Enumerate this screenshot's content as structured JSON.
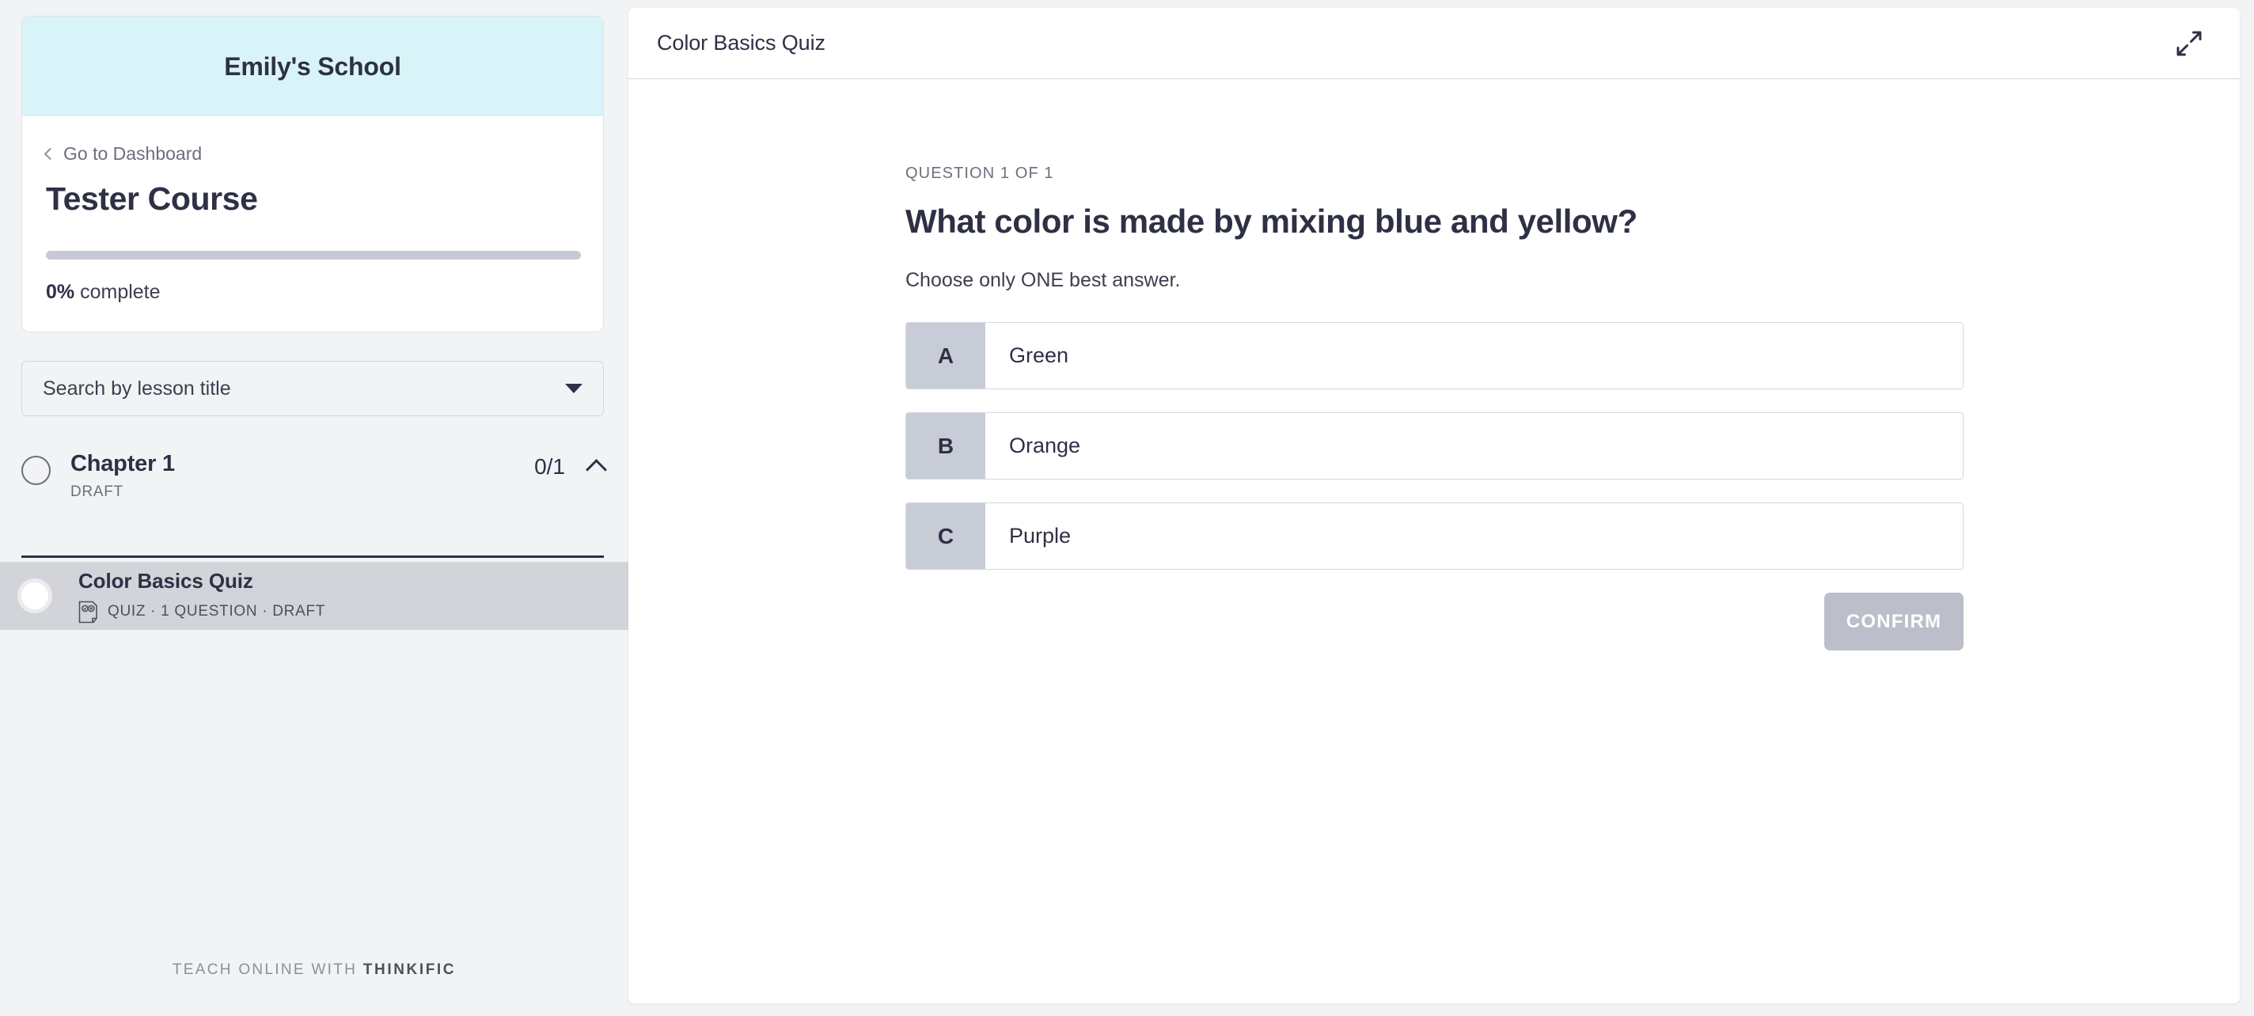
{
  "sidebar": {
    "school_name": "Emily's School",
    "back_link": "Go to Dashboard",
    "course_title": "Tester Course",
    "progress_percent": 0,
    "progress_value": "0%",
    "progress_suffix": "complete",
    "search_placeholder": "Search by lesson title",
    "chapter": {
      "title": "Chapter 1",
      "status": "DRAFT",
      "count": "0/1"
    },
    "lesson": {
      "title": "Color Basics Quiz",
      "meta": "QUIZ · 1 QUESTION ·  DRAFT"
    },
    "footer_prefix": "TEACH ONLINE WITH",
    "footer_brand": "THINKIFIC"
  },
  "main": {
    "panel_title": "Color Basics Quiz",
    "question_index": "QUESTION 1 OF 1",
    "question_text": "What color is made by mixing blue and yellow?",
    "question_hint": "Choose only ONE best answer.",
    "answers": [
      {
        "letter": "A",
        "text": "Green"
      },
      {
        "letter": "B",
        "text": "Orange"
      },
      {
        "letter": "C",
        "text": "Purple"
      }
    ],
    "confirm_label": "CONFIRM"
  },
  "colors": {
    "banner": "#d9f4f8",
    "page_bg": "#f2f3f5",
    "text_dark": "#2e3045",
    "text_muted": "#6b6f7d",
    "letter_box": "#c8ccd7",
    "confirm_disabled": "#bcbfc9",
    "selected_row": "#d2d4da"
  },
  "icons": {
    "back_chevron": "chevron-left-icon",
    "search_caret": "chevron-down-icon",
    "chapter_toggle": "chevron-up-icon",
    "quiz_type": "quiz-icon",
    "expand": "expand-icon"
  }
}
